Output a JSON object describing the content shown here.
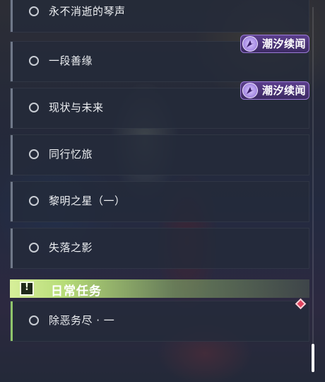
{
  "quests": [
    {
      "label": "永不消逝的琴声"
    },
    {
      "label": "一段善缘"
    },
    {
      "label": "现状与未来"
    },
    {
      "label": "同行忆旅"
    },
    {
      "label": "黎明之星（一）"
    },
    {
      "label": "失落之影"
    }
  ],
  "badges": [
    {
      "text": "潮汐续闻",
      "icon": "tide-icon"
    },
    {
      "text": "潮汐续闻",
      "icon": "tide-icon"
    }
  ],
  "daily": {
    "section_title": "日常任务",
    "section_icon": "!",
    "quests": [
      {
        "label": "除恶务尽 · 一"
      }
    ]
  },
  "colors": {
    "section_accent": "#b7dc78",
    "badge_purple": "#5b3e8c",
    "marker_red": "#e0445e"
  }
}
